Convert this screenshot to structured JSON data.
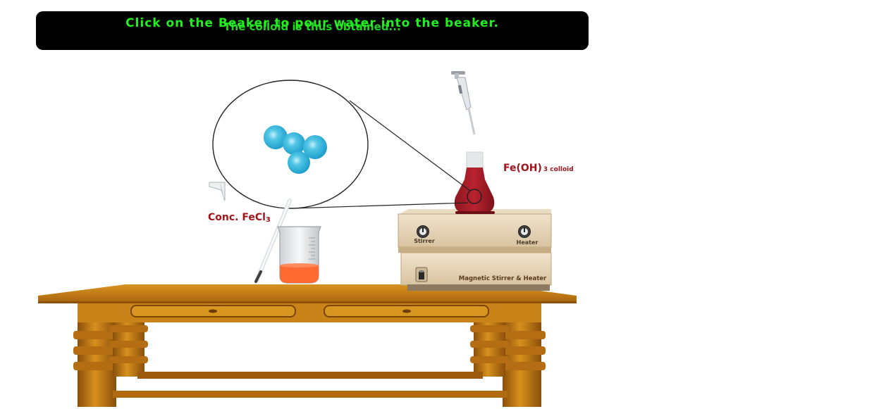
{
  "instructions": {
    "primary": "Click on the Beaker to pour water into the beaker.",
    "secondary": "The colloid is thus obtained..."
  },
  "labels": {
    "fecl3_prefix": "Conc. FeCl",
    "fecl3_sub": "3",
    "colloid_prefix": "Fe(OH)",
    "colloid_sub": "3 colloid",
    "stirrer": "Stirrer",
    "heater": "Heater",
    "device": "Magnetic Stirrer & Heater"
  },
  "colors": {
    "instruction_text": "#22ee22",
    "label_red": "#a0141c",
    "colloid_liquid": "#a31e27",
    "beaker_liquid": "#ff6a33",
    "particle_blue": "#3ab8dc",
    "table_wood": "#c27d1a"
  },
  "icons": [
    "micropipette-icon",
    "dropper-icon",
    "glass-rod-icon",
    "beaker-icon",
    "conical-flask-icon",
    "knob-icon",
    "power-switch-icon"
  ]
}
